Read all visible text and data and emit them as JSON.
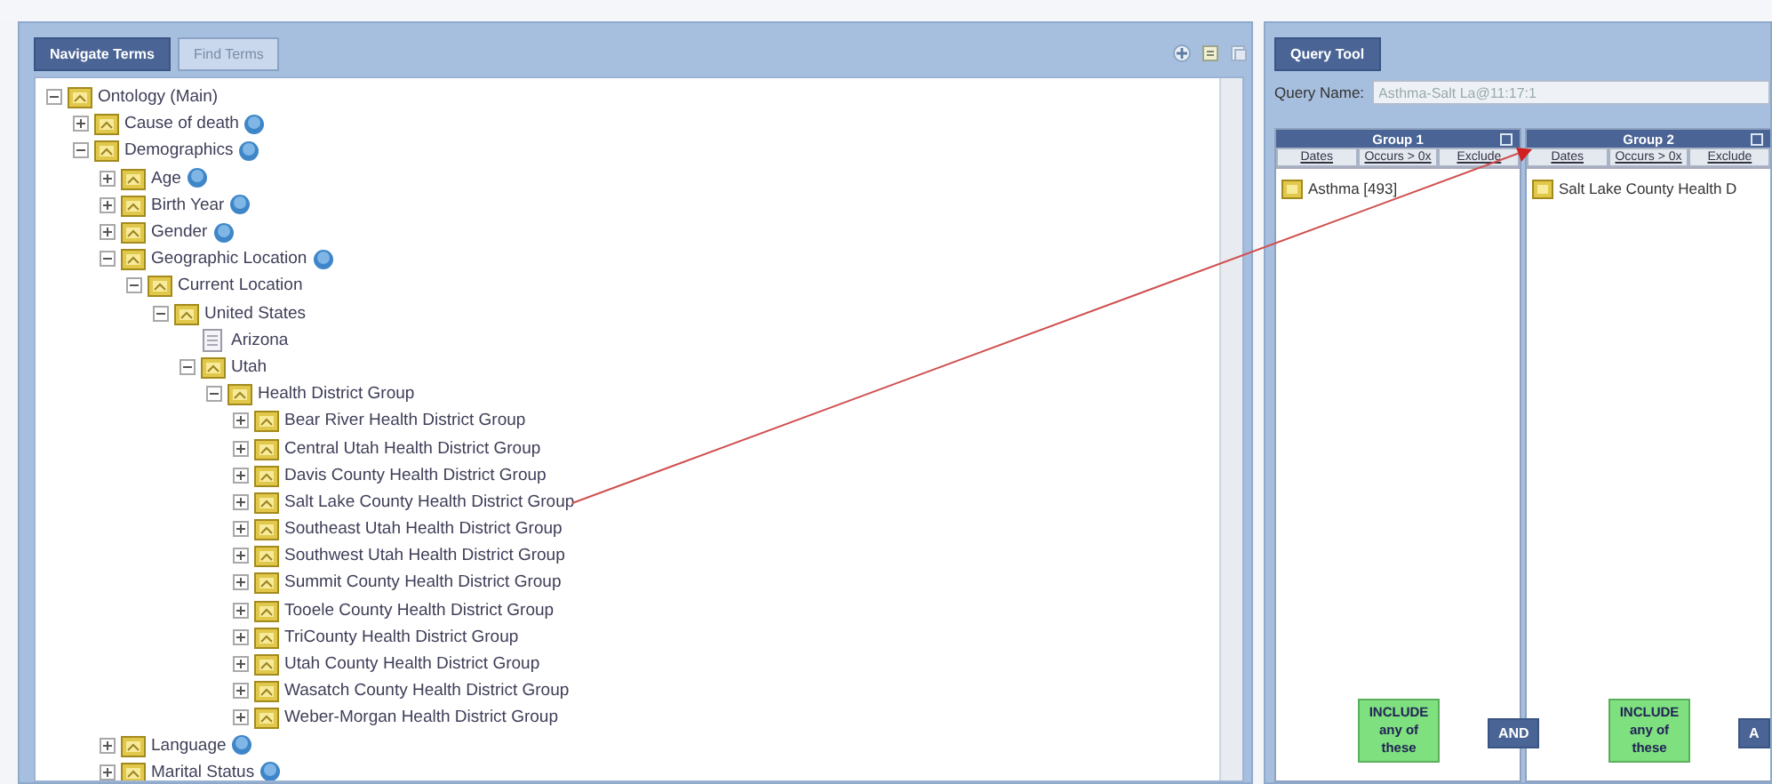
{
  "left_panel": {
    "tabs": [
      {
        "label": "Navigate Terms",
        "selected": true
      },
      {
        "label": "Find Terms",
        "selected": false
      }
    ],
    "tree": [
      {
        "label": "Ontology (Main)",
        "expanded": true,
        "kind": "folder",
        "info": false,
        "children": [
          {
            "label": "Cause of death",
            "expanded": false,
            "kind": "folder",
            "info": true
          },
          {
            "label": "Demographics",
            "expanded": true,
            "kind": "folder",
            "info": true,
            "children": [
              {
                "label": "Age",
                "expanded": false,
                "kind": "folder",
                "info": true
              },
              {
                "label": "Birth Year",
                "expanded": false,
                "kind": "folder",
                "info": true
              },
              {
                "label": "Gender",
                "expanded": false,
                "kind": "folder",
                "info": true
              },
              {
                "label": "Geographic Location",
                "expanded": true,
                "kind": "folder",
                "info": true,
                "children": [
                  {
                    "label": "Current Location",
                    "expanded": true,
                    "kind": "folder",
                    "info": false,
                    "children": [
                      {
                        "label": "United States",
                        "expanded": true,
                        "kind": "folder",
                        "info": false,
                        "children": [
                          {
                            "label": "Arizona",
                            "kind": "leaf",
                            "info": false
                          },
                          {
                            "label": "Utah",
                            "expanded": true,
                            "kind": "folder",
                            "info": false,
                            "children": [
                              {
                                "label": "Health District Group",
                                "expanded": true,
                                "kind": "folder",
                                "info": false,
                                "children": [
                                  {
                                    "label": "Bear River Health District Group",
                                    "expanded": false,
                                    "kind": "folder",
                                    "info": false
                                  },
                                  {
                                    "label": "Central Utah Health District Group",
                                    "expanded": false,
                                    "kind": "folder",
                                    "info": false
                                  },
                                  {
                                    "label": "Davis County Health District Group",
                                    "expanded": false,
                                    "kind": "folder",
                                    "info": false
                                  },
                                  {
                                    "label": "Salt Lake County Health District Group",
                                    "expanded": false,
                                    "kind": "folder",
                                    "info": false
                                  },
                                  {
                                    "label": "Southeast Utah Health District Group",
                                    "expanded": false,
                                    "kind": "folder",
                                    "info": false
                                  },
                                  {
                                    "label": "Southwest Utah Health District Group",
                                    "expanded": false,
                                    "kind": "folder",
                                    "info": false
                                  },
                                  {
                                    "label": "Summit County Health District Group",
                                    "expanded": false,
                                    "kind": "folder",
                                    "info": false
                                  },
                                  {
                                    "label": "Tooele County Health District Group",
                                    "expanded": false,
                                    "kind": "folder",
                                    "info": false
                                  },
                                  {
                                    "label": "TriCounty Health District Group",
                                    "expanded": false,
                                    "kind": "folder",
                                    "info": false
                                  },
                                  {
                                    "label": "Utah County Health District Group",
                                    "expanded": false,
                                    "kind": "folder",
                                    "info": false
                                  },
                                  {
                                    "label": "Wasatch County Health District Group",
                                    "expanded": false,
                                    "kind": "folder",
                                    "info": false
                                  },
                                  {
                                    "label": "Weber-Morgan Health District Group",
                                    "expanded": false,
                                    "kind": "folder",
                                    "info": false
                                  }
                                ]
                              }
                            ]
                          }
                        ]
                      }
                    ]
                  }
                ]
              },
              {
                "label": "Language",
                "expanded": false,
                "kind": "folder",
                "info": true
              },
              {
                "label": "Marital Status",
                "expanded": false,
                "kind": "folder",
                "info": true
              }
            ]
          }
        ]
      }
    ]
  },
  "query_tool": {
    "tab": {
      "label": "Query Tool",
      "selected": true
    },
    "query_name_label": "Query Name:",
    "query_name": "Asthma-Salt La@11:17:1",
    "groups": [
      {
        "title": "Group 1",
        "buttons": [
          "Dates",
          "Occurs > 0x",
          "Exclude"
        ],
        "items": [
          "Asthma [493]"
        ],
        "include": "INCLUDE any of these",
        "operator": "AND"
      },
      {
        "title": "Group 2",
        "buttons": [
          "Dates",
          "Occurs > 0x",
          "Exclude"
        ],
        "items": [
          "Salt Lake County Health D"
        ],
        "include": "INCLUDE any of these",
        "operator": "A"
      }
    ]
  }
}
